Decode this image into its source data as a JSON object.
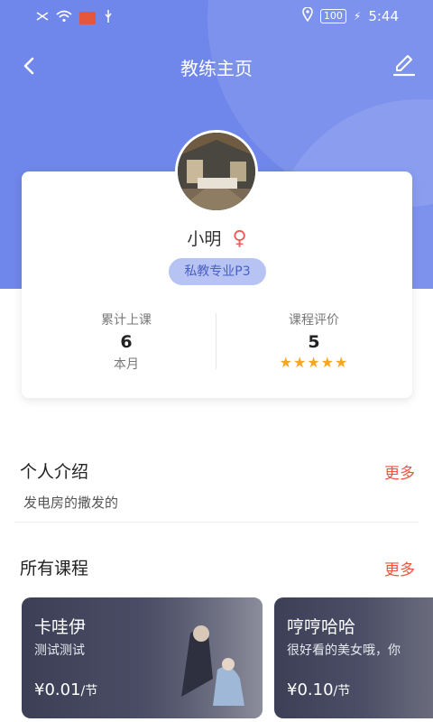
{
  "status_bar": {
    "left_icons": [
      "signal-icon",
      "wifi-icon",
      "notification-icon",
      "usb-icon"
    ],
    "battery": "100",
    "time": "5:44"
  },
  "header": {
    "title": "教练主页",
    "back_icon": "back-chevron-icon",
    "edit_icon": "edit-pencil-icon"
  },
  "profile": {
    "name": "小明",
    "gender_icon": "female-icon",
    "badge": "私教专业P3",
    "stats": {
      "classes_label": "累计上课",
      "classes_value": "6",
      "classes_period": "本月",
      "rating_label": "课程评价",
      "rating_value": "5",
      "rating_stars": 5
    }
  },
  "intro": {
    "title": "个人介绍",
    "more": "更多",
    "text": "发电房的撒发的"
  },
  "courses": {
    "title": "所有课程",
    "more": "更多",
    "items": [
      {
        "name": "卡哇伊",
        "desc": "测试测试",
        "price": "¥0.01",
        "unit": "/节"
      },
      {
        "name": "哼哼哈哈",
        "desc": "很好看的美女哦，你",
        "price": "¥0.10",
        "unit": "/节"
      }
    ]
  },
  "colors": {
    "accent": "#6f86ea",
    "more": "#e8573e",
    "star": "#f5a623",
    "badge_bg": "#b7c3f3"
  }
}
